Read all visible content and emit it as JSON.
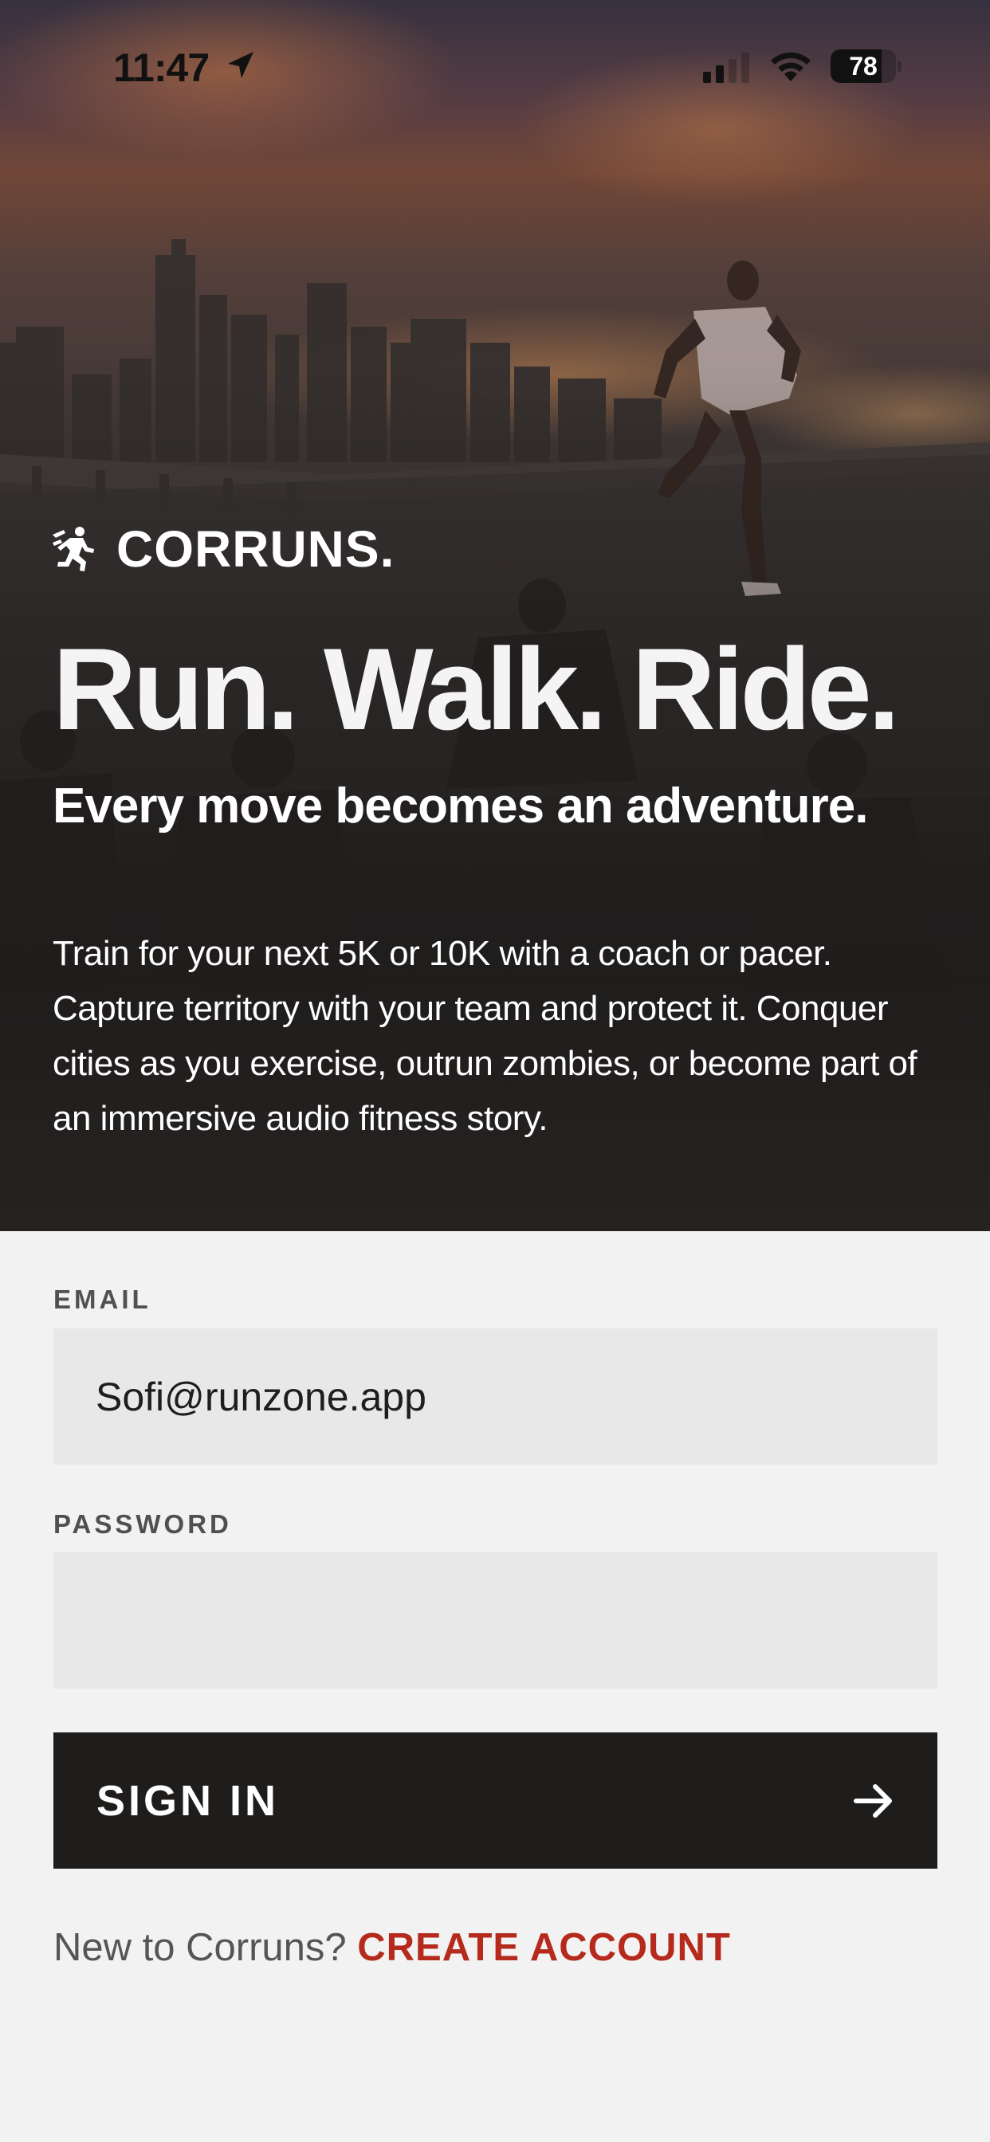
{
  "status_bar": {
    "time": "11:47",
    "battery": "78",
    "battery_level": 0.78
  },
  "hero": {
    "brand_name": "CORRUNS.",
    "headline": "Run. Walk. Ride.",
    "subheadline": "Every move becomes an adventure.",
    "description": "Train for your next 5K or 10K with a coach or pacer. Capture territory with your team and protect it. Conquer cities as you exercise, outrun zombies, or become part of an immersive audio fitness story."
  },
  "form": {
    "email_label": "EMAIL",
    "email_value": "Sofi@runzone.app",
    "password_label": "PASSWORD",
    "password_value": "",
    "signin_label": "SIGN IN",
    "footer_text": "New to Corruns?",
    "create_account_label": "CREATE ACCOUNT"
  },
  "icons": {
    "location": "location-arrow-icon",
    "signal": "cellular-signal-icon",
    "wifi": "wifi-icon",
    "battery": "battery-icon",
    "brand": "runner-logo-icon",
    "signin_arrow": "arrow-right-icon"
  },
  "colors": {
    "accent": "#b52a1c",
    "button": "#1f1d1c",
    "input_bg": "#e8e8e8",
    "page_bg": "#f2f2f2"
  }
}
